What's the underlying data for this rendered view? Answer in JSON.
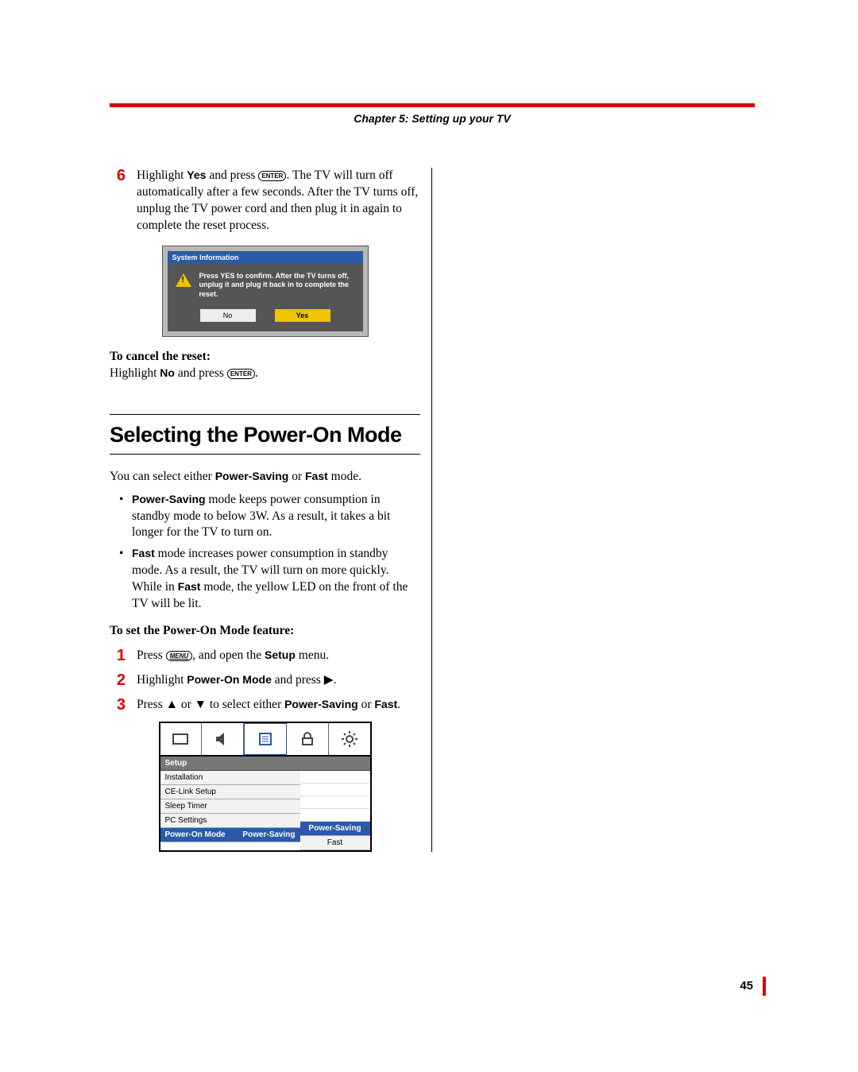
{
  "chapter": "Chapter 5: Setting up your TV",
  "step6": {
    "n": "6",
    "text1": "Highlight ",
    "yes": "Yes",
    "text2": " and press ",
    "enter": "ENTER",
    "text3": ". The TV will turn off automatically after a few seconds. After the TV turns off, unplug the TV power cord and then plug it in again to complete the reset process."
  },
  "dialog": {
    "title": "System Information",
    "msg": "Press YES to confirm. After the TV turns off, unplug it and plug it back in to complete the reset.",
    "no": "No",
    "yes": "Yes"
  },
  "cancel": {
    "head": "To cancel the reset:",
    "text1": "Highlight ",
    "no": "No",
    "text2": " and press ",
    "enter": "ENTER",
    "text3": "."
  },
  "section": {
    "title": "Selecting the Power-On Mode",
    "intro1": "You can select either ",
    "ps": "Power-Saving",
    "intro2": " or ",
    "fast": "Fast",
    "intro3": " mode.",
    "b1a": "Power-Saving",
    "b1b": " mode keeps power consumption in standby mode to below 3W. As a result, it takes a bit longer for the TV to turn on.",
    "b2a": "Fast",
    "b2b": " mode increases power consumption in standby mode. As a result, the TV will turn on more quickly. While in ",
    "b2c": "Fast",
    "b2d": " mode, the yellow LED on the front of the TV will be lit.",
    "subhead": "To set the Power-On Mode feature:"
  },
  "steps": {
    "s1n": "1",
    "s1a": "Press ",
    "s1menu": "MENU",
    "s1b": ", and open the ",
    "s1setup": "Setup",
    "s1c": " menu.",
    "s2n": "2",
    "s2a": "Highlight ",
    "s2pom": "Power-On Mode",
    "s2b": " and press ",
    "s2arrow": "▶",
    "s2c": ".",
    "s3n": "3",
    "s3a": "Press ",
    "s3up": "▲",
    "s3b": " or ",
    "s3dn": "▼",
    "s3c": " to select either ",
    "s3ps": "Power-Saving",
    "s3d": " or ",
    "s3fast": "Fast",
    "s3e": "."
  },
  "menu": {
    "cat": "Setup",
    "r1": "Installation",
    "r2": "CE-Link Setup",
    "r3": "Sleep Timer",
    "r4": "PC Settings",
    "r5l": "Power-On Mode",
    "r5r": "Power-Saving",
    "opt1": "Power-Saving",
    "opt2": "Fast"
  },
  "pagenum": "45"
}
